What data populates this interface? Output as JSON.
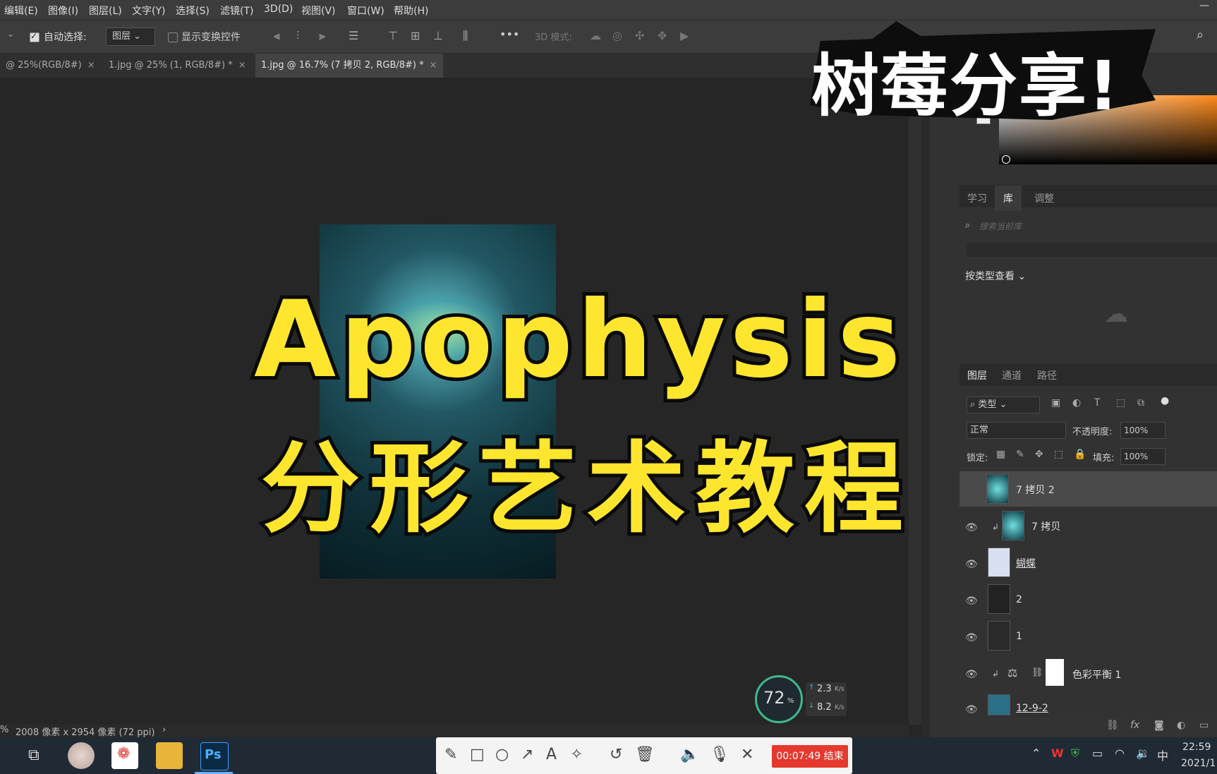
{
  "menubar": {
    "items": [
      "编辑(E)",
      "图像(I)",
      "图层(L)",
      "文字(Y)",
      "选择(S)",
      "滤镜(T)",
      "3D(D)",
      "视图(V)",
      "窗口(W)",
      "帮助(H)"
    ]
  },
  "options": {
    "auto_select_label": "自动选择:",
    "auto_select_value": "图层",
    "show_transform_label": "显示变换控件",
    "mode_3d_label": "3D 模式:",
    "more": "•••"
  },
  "tabs": [
    {
      "label": "@ 25%(RGB/8#)"
    },
    {
      "label": "1.jpg @ 25% (1, RGB/8#) *"
    },
    {
      "label": "1.jpg @ 16.7% (7 拷贝 2, RGB/8#) *"
    }
  ],
  "status": {
    "text": "2008 像素 x 2954 像素 (72 ppi)",
    "zoom": "%"
  },
  "overlay": {
    "title_en": "Apophysis",
    "title_cn": "分形艺术教程",
    "badge": "树莓分享!"
  },
  "libraries": {
    "tabs": [
      "学习",
      "库",
      "调整"
    ],
    "search_placeholder": "搜索当前库",
    "view_by": "按类型查看"
  },
  "layers_panel": {
    "tabs": [
      "图层",
      "通道",
      "路径"
    ],
    "filter": "类型",
    "blend": "正常",
    "opacity_label": "不透明度:",
    "opacity": "100%",
    "lock_label": "锁定:",
    "fill_label": "填充:",
    "fill": "100%",
    "layers": [
      {
        "name": "7 拷贝 2"
      },
      {
        "name": "7 拷贝"
      },
      {
        "name": "蝴蝶"
      },
      {
        "name": "2"
      },
      {
        "name": "1"
      },
      {
        "name": "色彩平衡 1"
      },
      {
        "name": "12-9-2"
      }
    ]
  },
  "net_monitor": {
    "percent": "72",
    "unit": "%",
    "up": "2.3",
    "down": "8.2",
    "rate_unit": "K/s"
  },
  "recorder": {
    "timer": "00:07:49 结束"
  },
  "tray": {
    "time": "22:59",
    "date": "2021/1",
    "ime": "中"
  }
}
